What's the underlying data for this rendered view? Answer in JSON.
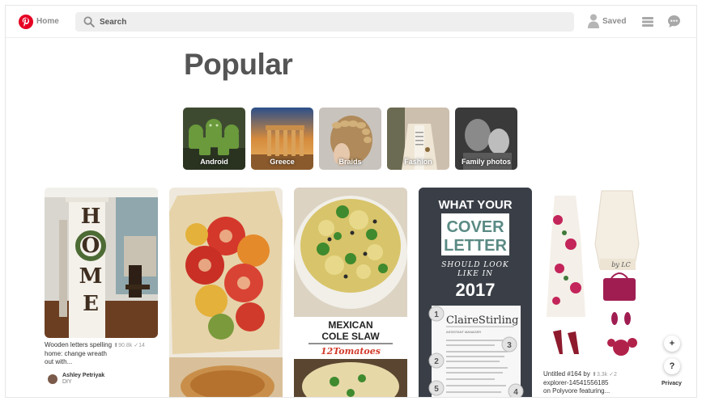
{
  "header": {
    "home_label": "Home",
    "search_placeholder": "Search",
    "saved_label": "Saved"
  },
  "page_title": "Popular",
  "topics": [
    {
      "label": "Android"
    },
    {
      "label": "Greece"
    },
    {
      "label": "Braids"
    },
    {
      "label": "Fashion"
    },
    {
      "label": "Family photos"
    }
  ],
  "pins": [
    {
      "image_letters": [
        "H",
        "O",
        "M",
        "E"
      ],
      "description": "Wooden letters spelling home: change wreath out with...",
      "desc_line1": "Wooden letters spelling",
      "desc_line2": "home: change wreath",
      "desc_line3": "out with...",
      "saves": "90.8k",
      "likes": "14",
      "author": "Ashley Petriyak",
      "board": "DIY"
    },
    {
      "description": ""
    },
    {
      "overlay_title_line1": "MEXICAN",
      "overlay_title_line2": "COLE SLAW",
      "overlay_brand": "12Tomatoes"
    },
    {
      "line1": "WHAT YOUR",
      "line2": "COVER",
      "line3": "LETTER",
      "line4": "SHOULD LOOK",
      "line5": "LIKE IN",
      "line6": "2017",
      "doc_name": "ClaireStirling",
      "doc_title": "ASSISTANT MANAGER",
      "badges": [
        "1",
        "2",
        "3",
        "5",
        "4"
      ]
    },
    {
      "desc_line1": "Untitled #164 by",
      "desc_line2": "explorer-14541556185",
      "desc_line3": "on Polyvore featuring...",
      "saves": "3.3k",
      "likes": "2",
      "monogram": "by LC"
    }
  ],
  "floating": {
    "plus": "+",
    "help": "?",
    "privacy": "Privacy"
  },
  "colors": {
    "brand": "#e60023",
    "cover_letter_bg": "#3a3f47",
    "cover_letter_accent": "#5a8a84"
  }
}
